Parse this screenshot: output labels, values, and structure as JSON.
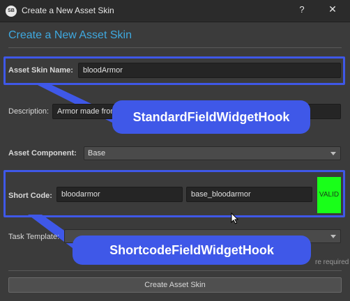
{
  "window": {
    "icon_text": "SB",
    "title": "Create a New Asset Skin",
    "help_label": "?",
    "close_label": "✕"
  },
  "heading": "Create a New Asset Skin",
  "fields": {
    "asset_skin_name": {
      "label": "Asset Skin Name:",
      "value": "bloodArmor"
    },
    "description": {
      "label": "Description:",
      "value": "Armor made from"
    },
    "asset_component": {
      "label": "Asset Component:",
      "value": "Base"
    },
    "short_code": {
      "label": "Short Code:",
      "value": "bloodarmor",
      "full_value": "base_bloodarmor",
      "status": "VALID"
    },
    "task_template": {
      "label": "Task Template:",
      "value": ""
    }
  },
  "callouts": {
    "standard": "StandardFieldWidgetHook",
    "shortcode": "ShortcodeFieldWidgetHook"
  },
  "required_note": "re required",
  "create_button": "Create Asset Skin",
  "colors": {
    "accent": "#3fa9e0",
    "highlight": "#3f58e8",
    "valid": "#19ff19"
  }
}
